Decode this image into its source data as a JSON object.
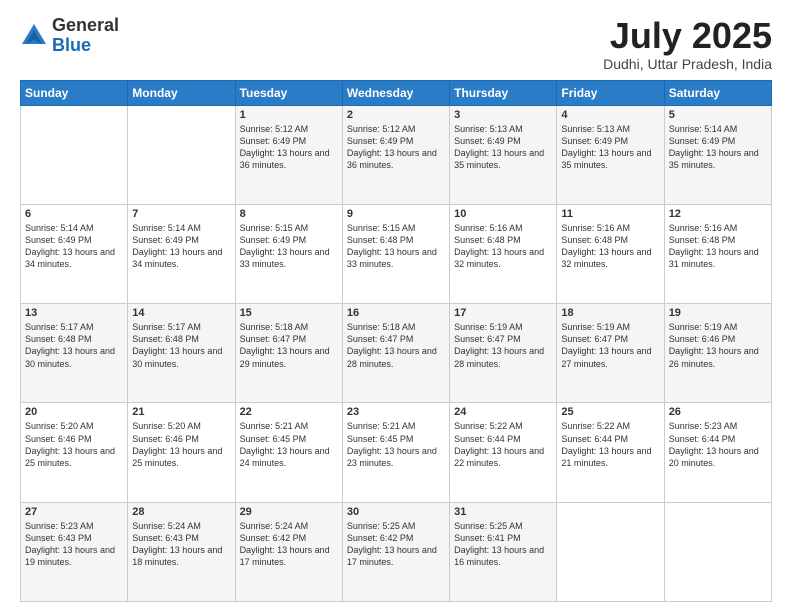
{
  "logo": {
    "general": "General",
    "blue": "Blue"
  },
  "header": {
    "month_title": "July 2025",
    "subtitle": "Dudhi, Uttar Pradesh, India"
  },
  "days_of_week": [
    "Sunday",
    "Monday",
    "Tuesday",
    "Wednesday",
    "Thursday",
    "Friday",
    "Saturday"
  ],
  "weeks": [
    [
      {
        "day": "",
        "info": ""
      },
      {
        "day": "",
        "info": ""
      },
      {
        "day": "1",
        "info": "Sunrise: 5:12 AM\nSunset: 6:49 PM\nDaylight: 13 hours and 36 minutes."
      },
      {
        "day": "2",
        "info": "Sunrise: 5:12 AM\nSunset: 6:49 PM\nDaylight: 13 hours and 36 minutes."
      },
      {
        "day": "3",
        "info": "Sunrise: 5:13 AM\nSunset: 6:49 PM\nDaylight: 13 hours and 35 minutes."
      },
      {
        "day": "4",
        "info": "Sunrise: 5:13 AM\nSunset: 6:49 PM\nDaylight: 13 hours and 35 minutes."
      },
      {
        "day": "5",
        "info": "Sunrise: 5:14 AM\nSunset: 6:49 PM\nDaylight: 13 hours and 35 minutes."
      }
    ],
    [
      {
        "day": "6",
        "info": "Sunrise: 5:14 AM\nSunset: 6:49 PM\nDaylight: 13 hours and 34 minutes."
      },
      {
        "day": "7",
        "info": "Sunrise: 5:14 AM\nSunset: 6:49 PM\nDaylight: 13 hours and 34 minutes."
      },
      {
        "day": "8",
        "info": "Sunrise: 5:15 AM\nSunset: 6:49 PM\nDaylight: 13 hours and 33 minutes."
      },
      {
        "day": "9",
        "info": "Sunrise: 5:15 AM\nSunset: 6:48 PM\nDaylight: 13 hours and 33 minutes."
      },
      {
        "day": "10",
        "info": "Sunrise: 5:16 AM\nSunset: 6:48 PM\nDaylight: 13 hours and 32 minutes."
      },
      {
        "day": "11",
        "info": "Sunrise: 5:16 AM\nSunset: 6:48 PM\nDaylight: 13 hours and 32 minutes."
      },
      {
        "day": "12",
        "info": "Sunrise: 5:16 AM\nSunset: 6:48 PM\nDaylight: 13 hours and 31 minutes."
      }
    ],
    [
      {
        "day": "13",
        "info": "Sunrise: 5:17 AM\nSunset: 6:48 PM\nDaylight: 13 hours and 30 minutes."
      },
      {
        "day": "14",
        "info": "Sunrise: 5:17 AM\nSunset: 6:48 PM\nDaylight: 13 hours and 30 minutes."
      },
      {
        "day": "15",
        "info": "Sunrise: 5:18 AM\nSunset: 6:47 PM\nDaylight: 13 hours and 29 minutes."
      },
      {
        "day": "16",
        "info": "Sunrise: 5:18 AM\nSunset: 6:47 PM\nDaylight: 13 hours and 28 minutes."
      },
      {
        "day": "17",
        "info": "Sunrise: 5:19 AM\nSunset: 6:47 PM\nDaylight: 13 hours and 28 minutes."
      },
      {
        "day": "18",
        "info": "Sunrise: 5:19 AM\nSunset: 6:47 PM\nDaylight: 13 hours and 27 minutes."
      },
      {
        "day": "19",
        "info": "Sunrise: 5:19 AM\nSunset: 6:46 PM\nDaylight: 13 hours and 26 minutes."
      }
    ],
    [
      {
        "day": "20",
        "info": "Sunrise: 5:20 AM\nSunset: 6:46 PM\nDaylight: 13 hours and 25 minutes."
      },
      {
        "day": "21",
        "info": "Sunrise: 5:20 AM\nSunset: 6:46 PM\nDaylight: 13 hours and 25 minutes."
      },
      {
        "day": "22",
        "info": "Sunrise: 5:21 AM\nSunset: 6:45 PM\nDaylight: 13 hours and 24 minutes."
      },
      {
        "day": "23",
        "info": "Sunrise: 5:21 AM\nSunset: 6:45 PM\nDaylight: 13 hours and 23 minutes."
      },
      {
        "day": "24",
        "info": "Sunrise: 5:22 AM\nSunset: 6:44 PM\nDaylight: 13 hours and 22 minutes."
      },
      {
        "day": "25",
        "info": "Sunrise: 5:22 AM\nSunset: 6:44 PM\nDaylight: 13 hours and 21 minutes."
      },
      {
        "day": "26",
        "info": "Sunrise: 5:23 AM\nSunset: 6:44 PM\nDaylight: 13 hours and 20 minutes."
      }
    ],
    [
      {
        "day": "27",
        "info": "Sunrise: 5:23 AM\nSunset: 6:43 PM\nDaylight: 13 hours and 19 minutes."
      },
      {
        "day": "28",
        "info": "Sunrise: 5:24 AM\nSunset: 6:43 PM\nDaylight: 13 hours and 18 minutes."
      },
      {
        "day": "29",
        "info": "Sunrise: 5:24 AM\nSunset: 6:42 PM\nDaylight: 13 hours and 17 minutes."
      },
      {
        "day": "30",
        "info": "Sunrise: 5:25 AM\nSunset: 6:42 PM\nDaylight: 13 hours and 17 minutes."
      },
      {
        "day": "31",
        "info": "Sunrise: 5:25 AM\nSunset: 6:41 PM\nDaylight: 13 hours and 16 minutes."
      },
      {
        "day": "",
        "info": ""
      },
      {
        "day": "",
        "info": ""
      }
    ]
  ]
}
